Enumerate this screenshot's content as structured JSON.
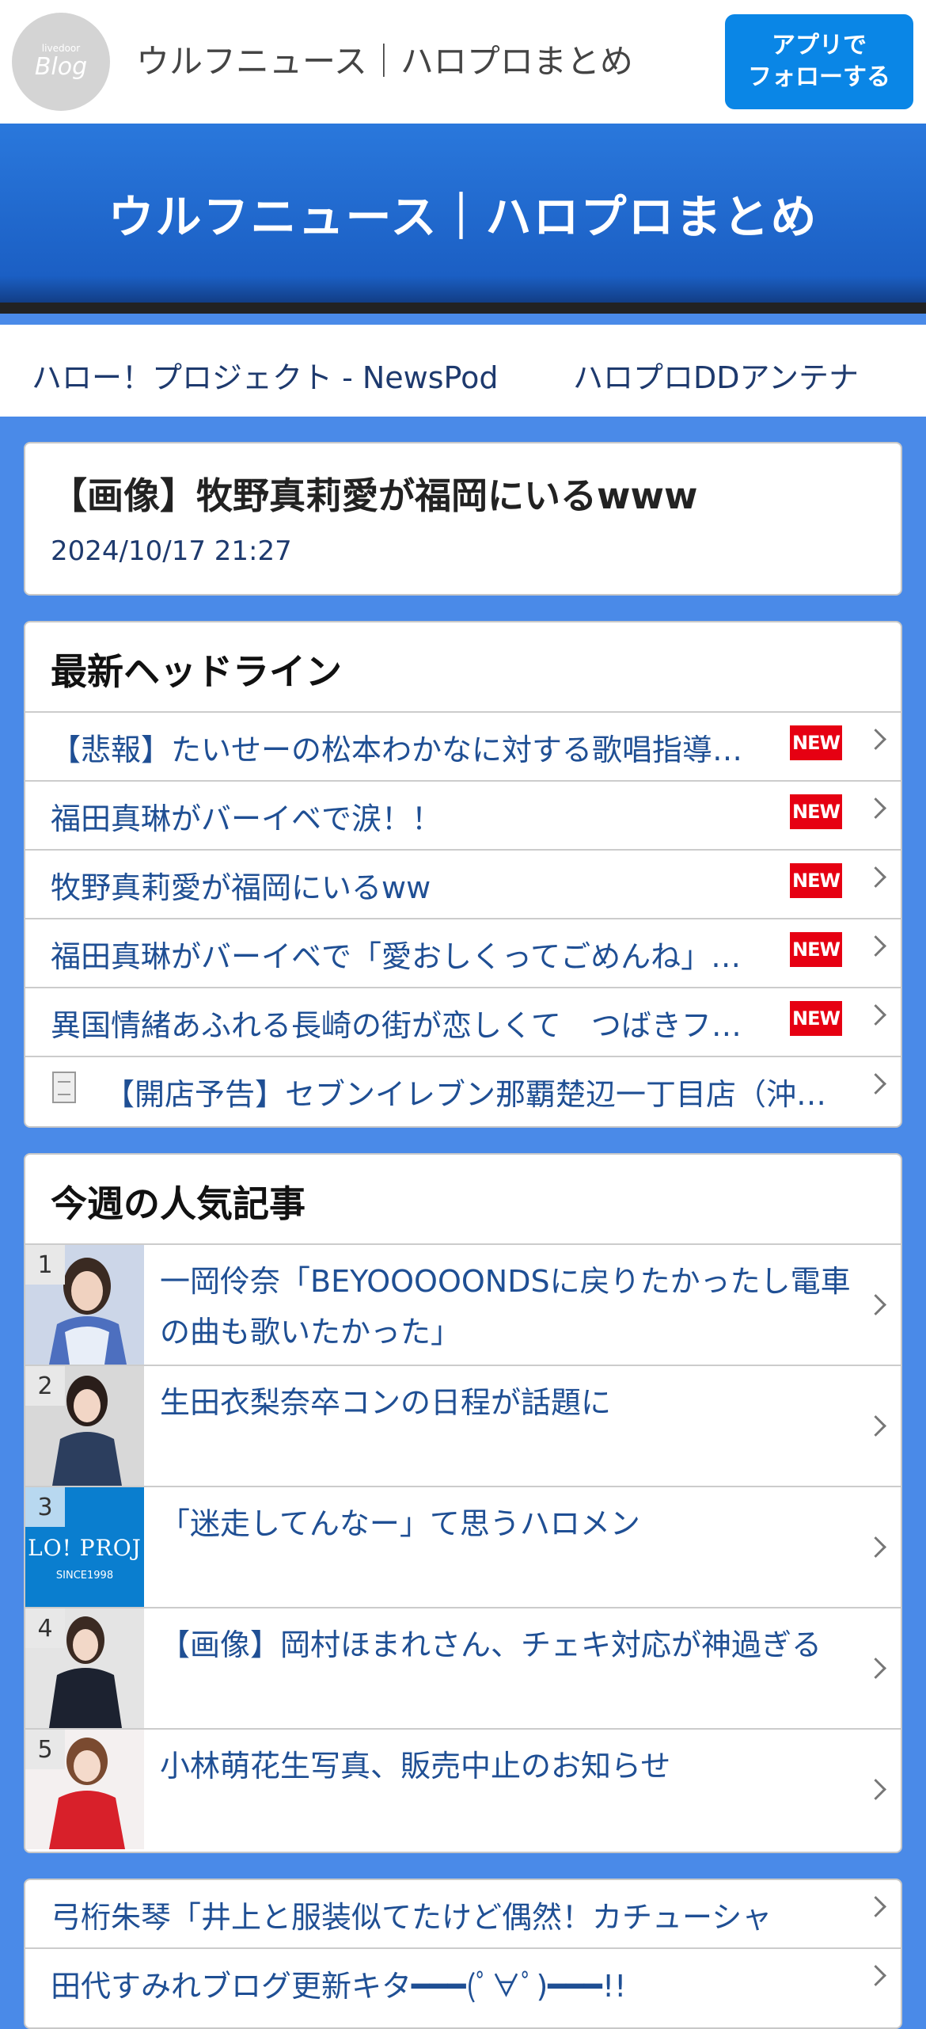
{
  "header": {
    "logo_small": "livedoor",
    "logo_big": "Blog",
    "site_title": "ウルフニュース｜ハロプロまとめ",
    "follow_line1": "アプリで",
    "follow_line2": "フォローする"
  },
  "banner": {
    "title": "ウルフニュース｜ハロプロまとめ"
  },
  "nav": {
    "link1": "ハロー！プロジェクト - NewsPod",
    "link2": "ハロプロDDアンテナ"
  },
  "article": {
    "title": "【画像】牧野真莉愛が福岡にいるwww",
    "date": "2024/10/17 21:27"
  },
  "headlines": {
    "heading": "最新ヘッドライン",
    "new_label": "NEW",
    "items": [
      "【悲報】たいせーの松本わかなに対する歌唱指導が厳しすぎる",
      "福田真琳がバーイベで涙！！",
      "牧野真莉愛が福岡にいるww",
      "福田真琳がバーイベで「愛おしくってごめんね」を歌う",
      "異国情緒あふれる長崎の街が恋しくて　つばきファクトリー",
      "【開店予告】セブンイレブン那覇楚辺一丁目店（沖縄県）"
    ]
  },
  "popular": {
    "heading": "今週の人気記事",
    "items": [
      {
        "rank": "1",
        "title": "一岡伶奈「BEYOOOOONDSに戻りたかったし電車の曲も歌いたかった」"
      },
      {
        "rank": "2",
        "title": "生田衣梨奈卒コンの日程が話題に"
      },
      {
        "rank": "3",
        "title": "「迷走してんなー」て思うハロメン",
        "thumb_text1": "LO! PROJ",
        "thumb_text2": "SINCE1998"
      },
      {
        "rank": "4",
        "title": "【画像】岡村ほまれさん、チェキ対応が神過ぎる"
      },
      {
        "rank": "5",
        "title": "小林萌花生写真、販売中止のお知らせ"
      }
    ]
  },
  "more": {
    "items": [
      "弓桁朱琴「井上と服装似てたけど偶然！カチューシャ",
      "田代すみれブログ更新キタ━━━(ﾟ∀ﾟ)━━━!!"
    ]
  },
  "colors": {
    "accent": "#0a86e6",
    "banner": "#1b5fc4",
    "background": "#4a8ae8",
    "new_badge": "#e60012",
    "link": "#1f4f94"
  }
}
